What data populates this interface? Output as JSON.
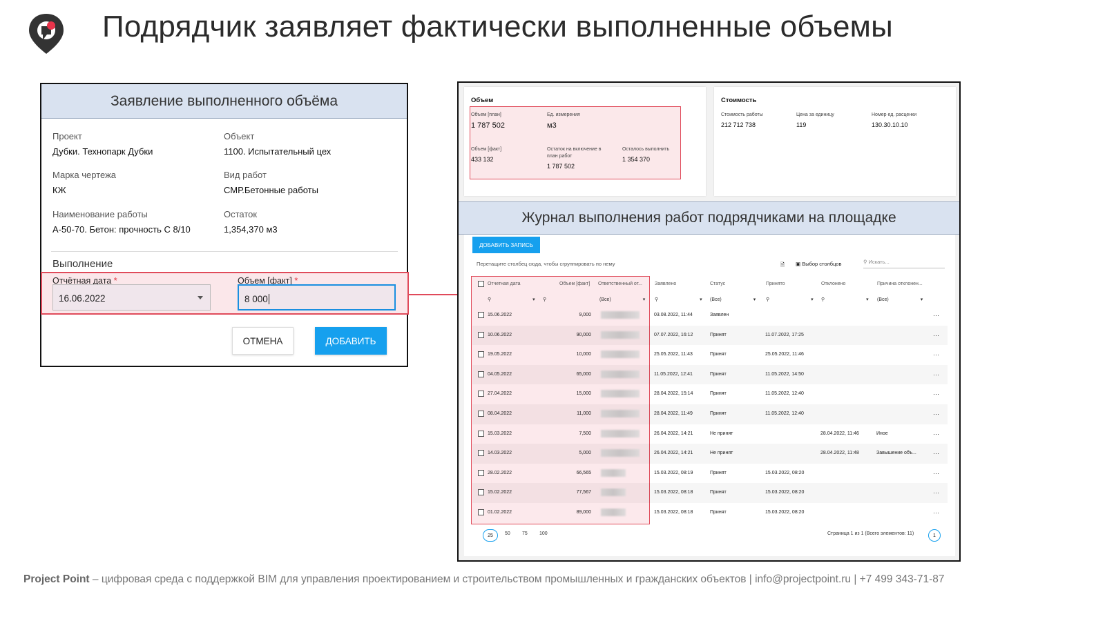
{
  "title": "Подрядчик заявляет фактически выполненные объемы",
  "dialog": {
    "title": "Заявление выполненного объёма",
    "fields": [
      {
        "label": "Проект",
        "value": "Дубки. Технопарк Дубки"
      },
      {
        "label": "Объект",
        "value": "1100. Испытательный цех"
      },
      {
        "label": "Марка чертежа",
        "value": "КЖ"
      },
      {
        "label": "Вид работ",
        "value": "СМР.Бетонные работы"
      },
      {
        "label": "Наименование работы",
        "value": "А-50-70. Бетон: прочность С 8/10"
      },
      {
        "label": "Остаток",
        "value": "1,354,370 м3"
      }
    ],
    "section": "Выполнение",
    "date_label": "Отчётная дата",
    "date_value": "16.06.2022",
    "volume_label": "Объем [факт]",
    "volume_value": "8 000",
    "required_mark": "*",
    "cancel": "ОТМЕНА",
    "add": "ДОБАВИТЬ"
  },
  "volume_card": {
    "title": "Объем",
    "plan_label": "Объем [план]",
    "plan_value": "1 787 502",
    "unit_label": "Ед. измерения",
    "unit_value": "м3",
    "fact_label": "Объем [факт]",
    "fact_value": "433 132",
    "remain_incl_label": "Остаток на включение в план работ",
    "remain_incl_value": "1 787 502",
    "remain_label": "Осталось выполнить",
    "remain_value": "1 354 370"
  },
  "cost_card": {
    "title": "Стоимость",
    "cost_label": "Стоимость работы",
    "cost_value": "212 712 738",
    "price_label": "Цена за единицу",
    "price_value": "119",
    "rate_label": "Номер ед. расценки",
    "rate_value": "130.30.10.10"
  },
  "journal": {
    "title": "Журнал выполнения работ подрядчиками на площадке",
    "add_record": "ДОБАВИТЬ ЗАПИСЬ",
    "group_hint": "Перетащите столбец сюда, чтобы сгруппировать по нему",
    "columns_btn": "Выбор столбцов",
    "search_placeholder": "Искать...",
    "headers": [
      "Отчетная дата",
      "Объем [факт]",
      "Ответственный от...",
      "Заявлено",
      "Статус",
      "Принято",
      "Отклонено",
      "Причина отклонен..."
    ],
    "filter_all": "(Все)",
    "rows": [
      {
        "date": "15.06.2022",
        "vol": "9,000",
        "declared": "03.08.2022, 11:44",
        "status": "Заявлен",
        "accepted": "",
        "rejected": "",
        "reason": ""
      },
      {
        "date": "10.06.2022",
        "vol": "90,000",
        "declared": "07.07.2022, 16:12",
        "status": "Принят",
        "accepted": "11.07.2022, 17:25",
        "rejected": "",
        "reason": ""
      },
      {
        "date": "19.05.2022",
        "vol": "10,000",
        "declared": "25.05.2022, 11:43",
        "status": "Принят",
        "accepted": "25.05.2022, 11:46",
        "rejected": "",
        "reason": ""
      },
      {
        "date": "04.05.2022",
        "vol": "65,000",
        "declared": "11.05.2022, 12:41",
        "status": "Принят",
        "accepted": "11.05.2022, 14:50",
        "rejected": "",
        "reason": ""
      },
      {
        "date": "27.04.2022",
        "vol": "15,000",
        "declared": "28.04.2022, 15:14",
        "status": "Принят",
        "accepted": "11.05.2022, 12:40",
        "rejected": "",
        "reason": ""
      },
      {
        "date": "08.04.2022",
        "vol": "11,000",
        "declared": "28.04.2022, 11:49",
        "status": "Принят",
        "accepted": "11.05.2022, 12:40",
        "rejected": "",
        "reason": ""
      },
      {
        "date": "15.03.2022",
        "vol": "7,500",
        "declared": "26.04.2022, 14:21",
        "status": "Не принят",
        "accepted": "",
        "rejected": "28.04.2022, 11:46",
        "reason": "Иное"
      },
      {
        "date": "14.03.2022",
        "vol": "5,000",
        "declared": "26.04.2022, 14:21",
        "status": "Не принят",
        "accepted": "",
        "rejected": "28.04.2022, 11:48",
        "reason": "Завышение объ..."
      },
      {
        "date": "28.02.2022",
        "vol": "66,565",
        "declared": "15.03.2022, 08:19",
        "status": "Принят",
        "accepted": "15.03.2022, 08:20",
        "rejected": "",
        "reason": ""
      },
      {
        "date": "15.02.2022",
        "vol": "77,567",
        "declared": "15.03.2022, 08:18",
        "status": "Принят",
        "accepted": "15.03.2022, 08:20",
        "rejected": "",
        "reason": ""
      },
      {
        "date": "01.02.2022",
        "vol": "89,000",
        "declared": "15.03.2022, 08:18",
        "status": "Принят",
        "accepted": "15.03.2022, 08:20",
        "rejected": "",
        "reason": ""
      }
    ],
    "page_sizes": [
      "25",
      "50",
      "75",
      "100"
    ],
    "page_info": "Страница 1 из 1 (Всего элементов: 11)",
    "page_num": "1"
  },
  "footer": {
    "brand": "Project Point",
    "text": " – цифровая среда с поддержкой BIM для управления проектированием и строительством промышленных и гражданских объектов | info@projectpoint.ru | +7 499 343-71-87"
  },
  "colors": {
    "accent": "#16a0ee",
    "highlight": "#e04a5a",
    "header_bg": "#d9e2f0"
  }
}
